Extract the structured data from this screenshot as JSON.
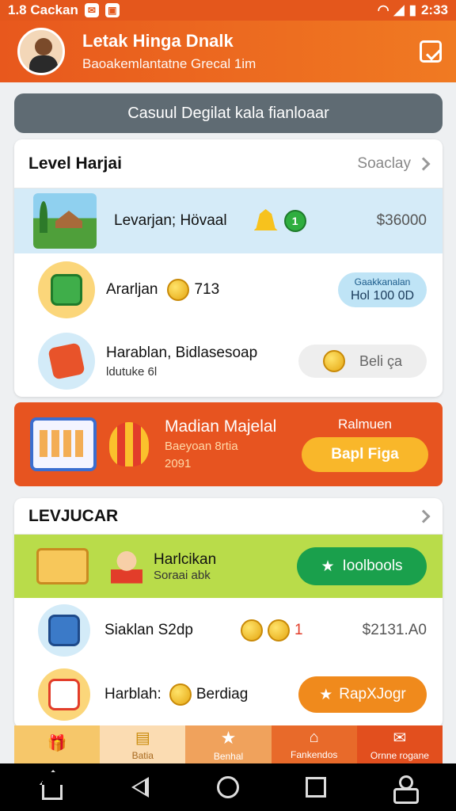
{
  "status_bar": {
    "carrier": "1.8 Cackan",
    "time": "2:33"
  },
  "header": {
    "title": "Letak Hinga Dnalk",
    "subtitle": "Baoakemlantatne Grecal 1im"
  },
  "banner": {
    "text": "Casuul Degilat kala fianloaar"
  },
  "section1": {
    "title": "Level Harjai",
    "link": "Soaclay",
    "featured": {
      "name": "Levarjan; Hövaal",
      "badge": "1",
      "price": "$36000"
    },
    "items": [
      {
        "name": "Ararljan",
        "amount": "713",
        "pill_top": "Gaakkanalan",
        "pill_bottom": "Hol 100 0D"
      },
      {
        "name_line1": "Harablan, Bidlasesoap",
        "name_line2": "ldutuke 6l",
        "pill_label": "Beli ça"
      }
    ]
  },
  "promo": {
    "title": "Madian Majelal",
    "subtitle_line1": "Baeyoan 8rtia",
    "subtitle_line2": "2091",
    "label": "Ralmuen",
    "button": "Bapl Figa"
  },
  "section2": {
    "title": "LEVJUCAR",
    "featured": {
      "title": "Harlcikan",
      "subtitle": "Soraai abk",
      "button": "Ioolbools"
    },
    "items": [
      {
        "name": "Siaklan S2dp",
        "badge": "1",
        "price": "$2131.A0"
      },
      {
        "name": "Harblah:",
        "extra": "Berdiag",
        "button": "RapXJogr"
      }
    ]
  },
  "tabbar": {
    "tabs": [
      {
        "label": "",
        "icon": "gift-icon",
        "color": "#f6c76a"
      },
      {
        "label": "Batia",
        "icon": "coupon-icon",
        "color": "#fbdcb2"
      },
      {
        "label": "Benhal",
        "icon": "star-icon",
        "color": "#f0a25c"
      },
      {
        "label": "Fankendos",
        "icon": "home-icon",
        "color": "#e86a2a"
      },
      {
        "label": "Ornne rogane",
        "icon": "mail-icon",
        "color": "#e24f1e"
      }
    ]
  },
  "colors": {
    "primary": "#e8581d",
    "banner": "#5f6b73",
    "highlight": "#d5ebf8",
    "green": "#1aa04c",
    "yellow": "#f9b72a"
  }
}
